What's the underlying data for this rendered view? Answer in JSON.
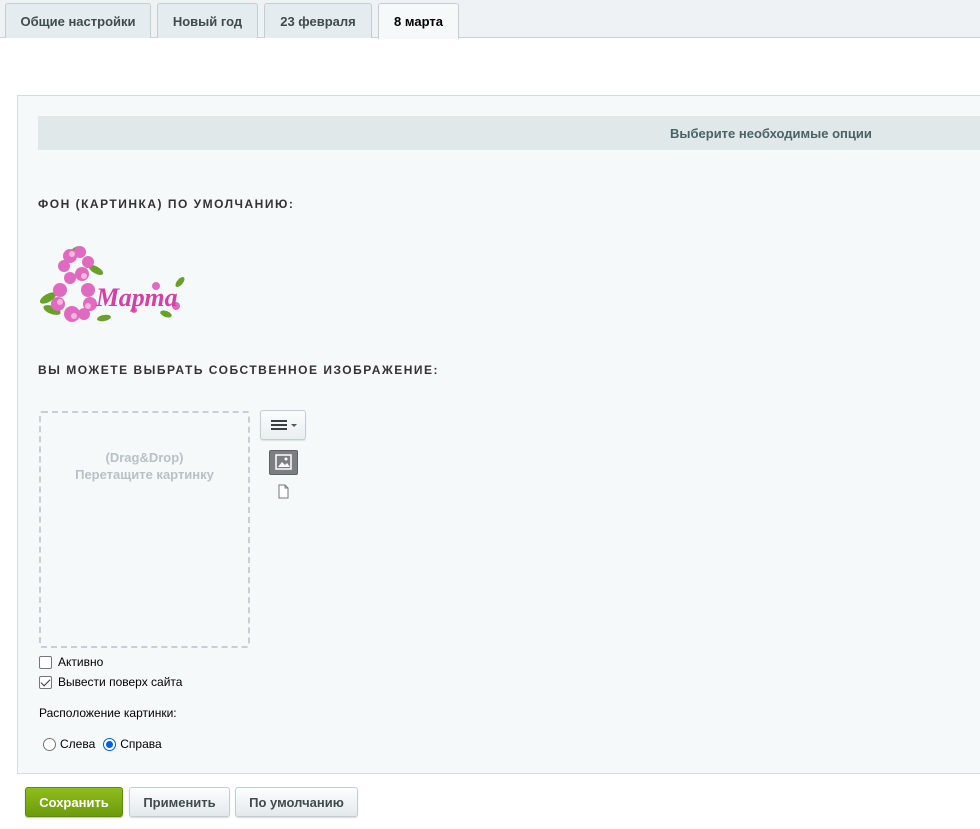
{
  "tabs": [
    {
      "label": "Общие настройки",
      "active": false
    },
    {
      "label": "Новый год",
      "active": false
    },
    {
      "label": "23 февраля",
      "active": false
    },
    {
      "label": "8 марта",
      "active": true
    }
  ],
  "panel": {
    "heading": "Выберите необходимые опции",
    "default_bg_title": "ФОН (КАРТИНКА) ПО УМОЛЧАНИЮ:",
    "default_image_text": "Марта",
    "default_image_digit": "8",
    "custom_image_title": "ВЫ МОЖЕТЕ ВЫБРАТЬ СОБСТВЕННОЕ ИЗОБРАЖЕНИЕ:",
    "dropzone": {
      "line1": "(Drag&Drop)",
      "line2": "Перетащите картинку"
    },
    "checkboxes": [
      {
        "label": "Активно",
        "checked": false
      },
      {
        "label": "Вывести поверх сайта",
        "checked": true
      }
    ],
    "position_label": "Расположение картинки:",
    "position_options": [
      {
        "label": "Слева",
        "selected": false
      },
      {
        "label": "Справа",
        "selected": true
      }
    ]
  },
  "footer": {
    "save_label": "Сохранить",
    "apply_label": "Применить",
    "default_label": "По умолчанию"
  },
  "colors": {
    "primary_button": "#7aab12",
    "heading_bar": "#e0e8ea",
    "panel_bg": "#f5f9f9",
    "accent_pink": "#d63fa6",
    "radio_accent": "#0060df"
  }
}
